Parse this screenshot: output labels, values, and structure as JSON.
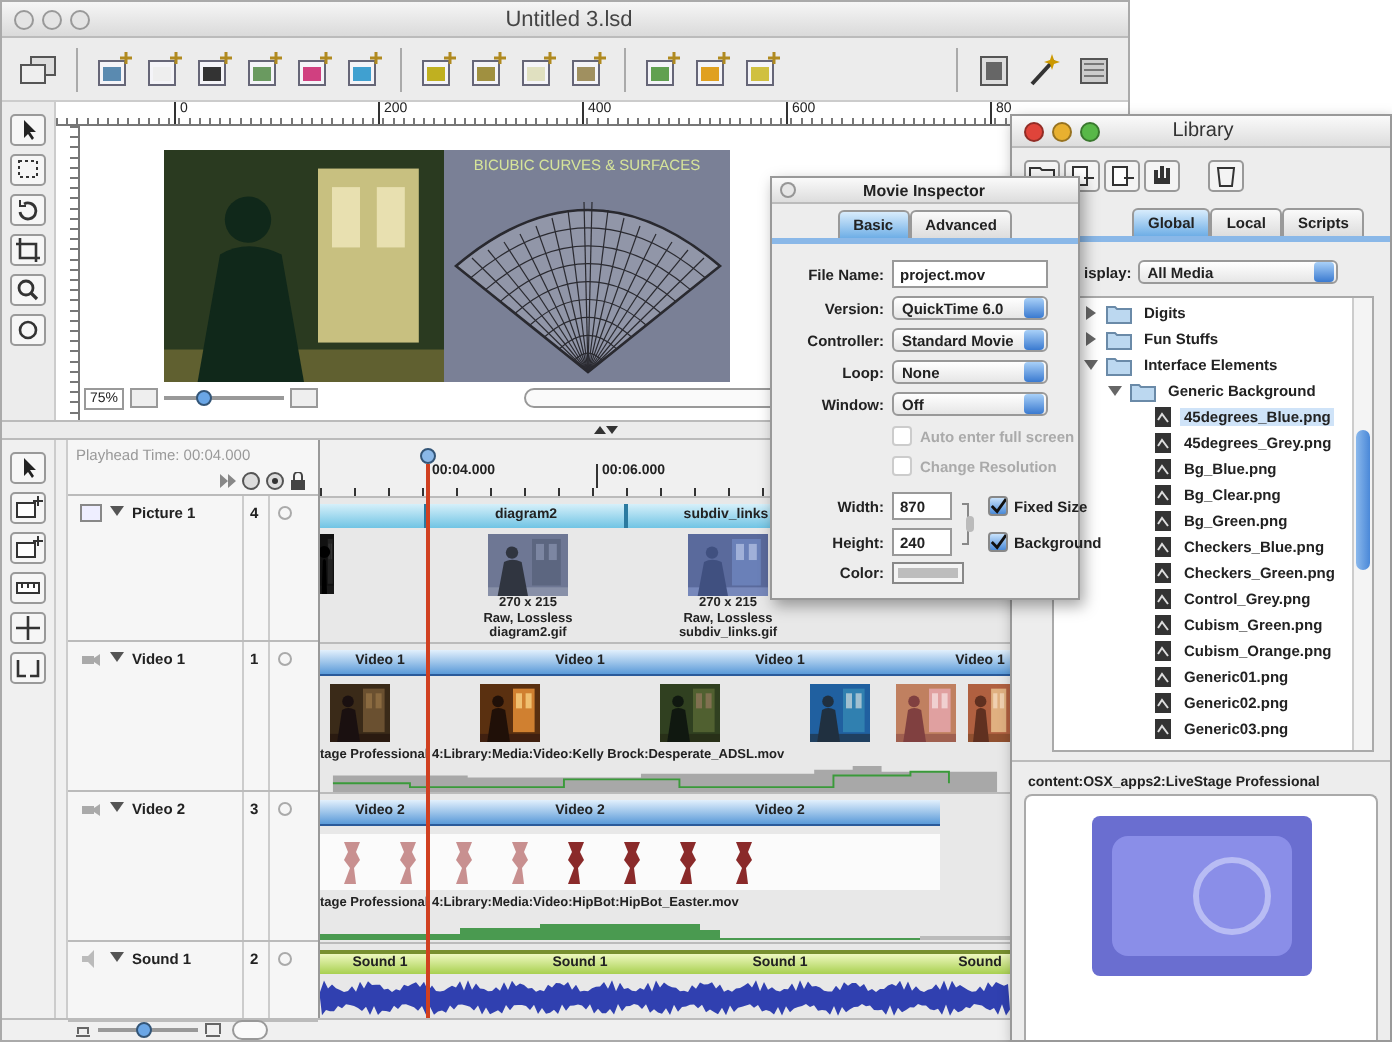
{
  "main_window": {
    "title": "Untitled 3.lsd",
    "stage": {
      "ruler_labels": [
        "0",
        "200",
        "400",
        "600",
        "80"
      ],
      "caption": "BICUBIC CURVES & SURFACES",
      "zoom": "75%",
      "zoom_slider": {
        "level": 0.3
      }
    },
    "timeline": {
      "playhead_time": "Playhead Time: 00:04.000",
      "ruler_labels": [
        "00:04.000",
        "00:06.000"
      ],
      "zoom_slider": {
        "level": 0.45
      },
      "tracks": [
        {
          "kind": "picture",
          "name": "Picture 1",
          "number": "4",
          "expanded": true,
          "clips": [
            {
              "label": "diagram2",
              "caption": [
                "270 x 215",
                "Raw, Lossless",
                "diagram2.gif"
              ]
            },
            {
              "label": "subdiv_links",
              "caption": [
                "270 x 215",
                "Raw, Lossless",
                "subdiv_links.gif"
              ]
            }
          ]
        },
        {
          "kind": "video",
          "name": "Video 1",
          "number": "1",
          "expanded": true,
          "clips": [
            "Video 1",
            "Video 1",
            "Video 1",
            "Video 1"
          ],
          "source": "tage Professional 4:Library:Media:Video:Kelly Brock:Desperate_ADSL.mov"
        },
        {
          "kind": "video",
          "name": "Video 2",
          "number": "3",
          "expanded": true,
          "clips": [
            "Video 2",
            "Video 2",
            "Video 2"
          ],
          "source": "tage Professional 4:Library:Media:Video:HipBot:HipBot_Easter.mov"
        },
        {
          "kind": "sound",
          "name": "Sound 1",
          "number": "2",
          "expanded": true,
          "clips": [
            "Sound 1",
            "Sound 1",
            "Sound 1",
            "Sound"
          ]
        }
      ]
    }
  },
  "inspector": {
    "title": "Movie Inspector",
    "tabs": [
      {
        "label": "Basic",
        "selected": true
      },
      {
        "label": "Advanced",
        "selected": false
      }
    ],
    "fields": [
      {
        "kind": "text",
        "label": "File Name:",
        "value": "project.mov"
      },
      {
        "kind": "popup",
        "label": "Version:",
        "value": "QuickTime 6.0"
      },
      {
        "kind": "popup",
        "label": "Controller:",
        "value": "Standard Movie"
      },
      {
        "kind": "popup",
        "label": "Loop:",
        "value": "None"
      },
      {
        "kind": "popup",
        "label": "Window:",
        "value": "Off"
      }
    ],
    "options": [
      {
        "label": "Auto enter full screen",
        "checked": false,
        "disabled": true
      },
      {
        "label": "Change Resolution",
        "checked": false,
        "disabled": true
      }
    ],
    "size": [
      {
        "label": "Width:",
        "value": "870",
        "option": {
          "label": "Fixed Size",
          "checked": true
        }
      },
      {
        "label": "Height:",
        "value": "240",
        "option": {
          "label": "Background",
          "checked": true
        }
      }
    ],
    "color_label": "Color:"
  },
  "library": {
    "title": "Library",
    "tabs": [
      {
        "label": "Global",
        "selected": true
      },
      {
        "label": "Local",
        "selected": false
      },
      {
        "label": "Scripts",
        "selected": false
      }
    ],
    "display": {
      "label": "isplay:",
      "value": "All Media"
    },
    "tree": [
      {
        "label": "Digits",
        "expanded": false,
        "selected": false
      },
      {
        "label": "Fun Stuffs",
        "expanded": false,
        "selected": false
      },
      {
        "label": "Interface Elements",
        "expanded": true,
        "selected": false,
        "children": [
          {
            "label": "Generic Background",
            "expanded": true,
            "selected": false,
            "children": [
              {
                "label": "45degrees_Blue.png",
                "selected": true
              },
              {
                "label": "45degrees_Grey.png",
                "selected": false
              },
              {
                "label": "Bg_Blue.png",
                "selected": false
              },
              {
                "label": "Bg_Clear.png",
                "selected": false
              },
              {
                "label": "Bg_Green.png",
                "selected": false
              },
              {
                "label": "Checkers_Blue.png",
                "selected": false
              },
              {
                "label": "Checkers_Green.png",
                "selected": false
              },
              {
                "label": "Control_Grey.png",
                "selected": false
              },
              {
                "label": "Cubism_Green.png",
                "selected": false
              },
              {
                "label": "Cubism_Orange.png",
                "selected": false
              },
              {
                "label": "Generic01.png",
                "selected": false
              },
              {
                "label": "Generic02.png",
                "selected": false
              },
              {
                "label": "Generic03.png",
                "selected": false
              }
            ]
          }
        ]
      }
    ],
    "path": "content:OSX_apps2:LiveStage Professional"
  }
}
